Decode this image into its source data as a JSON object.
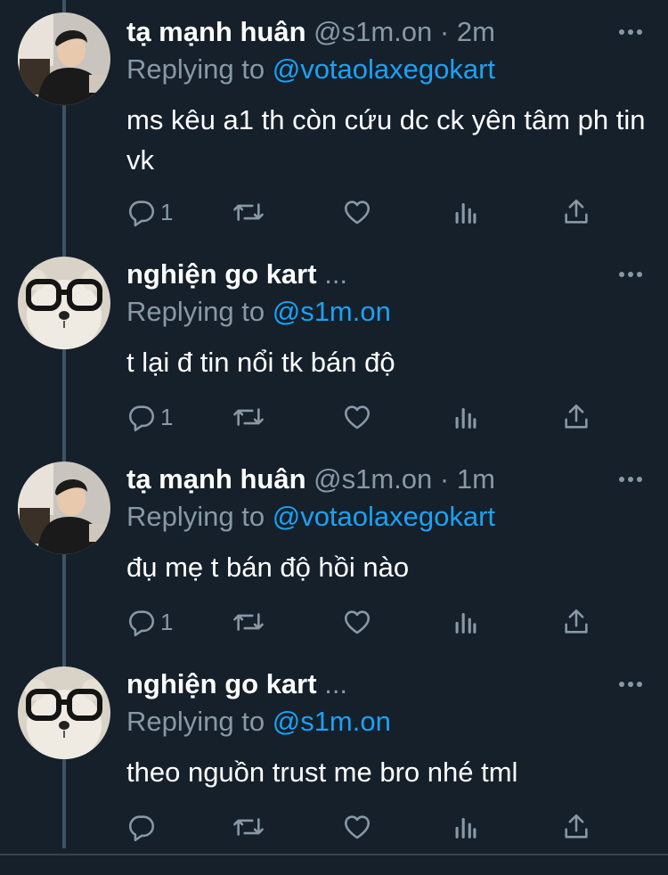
{
  "colors": {
    "background": "#15202b",
    "secondary_text": "#8899a6",
    "link": "#1da1f2",
    "thread_line": "#3d5466"
  },
  "tweets": [
    {
      "name": "tạ mạnh huân",
      "handle": "@s1m.on",
      "separator": "·",
      "time": "2m",
      "reply_prefix": "Replying to ",
      "reply_to": "@votaolaxegokart",
      "text": "ms kêu a1 th còn cứu dc ck yên tâm ph tin vk",
      "reply_count": "1",
      "avatar": "user-photo-avatar"
    },
    {
      "name": "nghiện go kart",
      "ellipsis": "...",
      "reply_prefix": "Replying to ",
      "reply_to": "@s1m.on",
      "text": "t lại đ tin nổi tk bán độ",
      "reply_count": "1",
      "avatar": "bear-with-glasses-avatar"
    },
    {
      "name": "tạ mạnh huân",
      "handle": "@s1m.on",
      "separator": "·",
      "time": "1m",
      "reply_prefix": "Replying to ",
      "reply_to": "@votaolaxegokart",
      "text": "đụ mẹ t bán độ hồi nào",
      "reply_count": "1",
      "avatar": "user-photo-avatar"
    },
    {
      "name": "nghiện go kart",
      "ellipsis": "...",
      "reply_prefix": "Replying to ",
      "reply_to": "@s1m.on",
      "text": "theo nguồn trust me bro nhé tml",
      "reply_count": "",
      "avatar": "bear-with-glasses-avatar"
    }
  ],
  "icons": [
    "reply-icon",
    "retweet-icon",
    "like-icon",
    "analytics-icon",
    "share-icon",
    "more-icon"
  ]
}
